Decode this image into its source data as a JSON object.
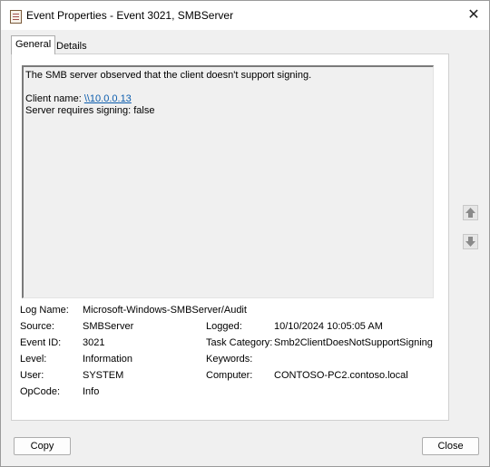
{
  "window": {
    "title": "Event Properties - Event 3021, SMBServer",
    "close_glyph": "✕"
  },
  "tabs": [
    {
      "label": "General",
      "active": true
    },
    {
      "label": "Details",
      "active": false
    }
  ],
  "description": {
    "line1": "The SMB server observed that the client doesn't support signing.",
    "client_label": "Client name: ",
    "client_link": "\\\\10.0.0.13",
    "signing_line": "Server requires signing: false"
  },
  "properties": {
    "log_name": {
      "label": "Log Name:",
      "value": "Microsoft-Windows-SMBServer/Audit"
    },
    "source": {
      "label": "Source:",
      "value": "SMBServer"
    },
    "logged": {
      "label": "Logged:",
      "value": "10/10/2024 10:05:05 AM"
    },
    "event_id": {
      "label": "Event ID:",
      "value": "3021"
    },
    "task_category": {
      "label": "Task Category:",
      "value": "Smb2ClientDoesNotSupportSigning"
    },
    "level": {
      "label": "Level:",
      "value": "Information"
    },
    "keywords": {
      "label": "Keywords:",
      "value": ""
    },
    "user": {
      "label": "User:",
      "value": "SYSTEM"
    },
    "computer": {
      "label": "Computer:",
      "value": "CONTOSO-PC2.contoso.local"
    },
    "opcode": {
      "label": "OpCode:",
      "value": "Info"
    }
  },
  "navigation": {
    "up_icon": "arrow-up-icon",
    "down_icon": "arrow-down-icon"
  },
  "buttons": {
    "copy": "Copy",
    "close": "Close"
  }
}
